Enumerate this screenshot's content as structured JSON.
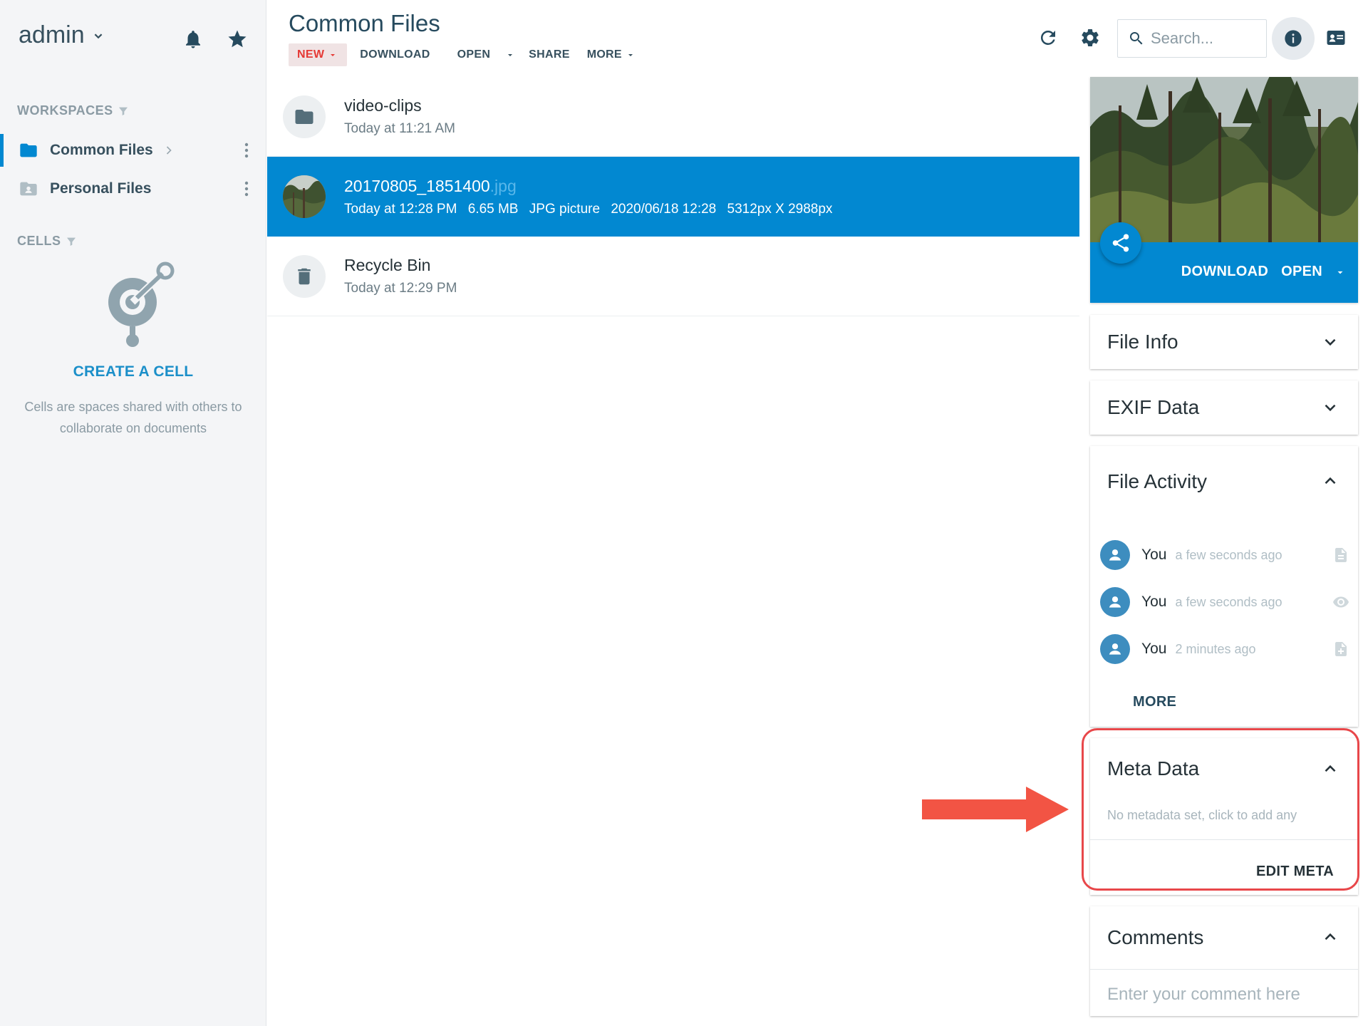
{
  "sidebar": {
    "username": "admin",
    "workspaces_title": "WORKSPACES",
    "workspaces": [
      {
        "label": "Common Files",
        "icon": "folder-icon",
        "active": true
      },
      {
        "label": "Personal Files",
        "icon": "personal-folder-icon",
        "active": false
      }
    ],
    "cells_title": "CELLS",
    "create_cell": "CREATE A CELL",
    "cells_description": "Cells are spaces shared with others to collaborate on documents"
  },
  "header": {
    "title": "Common Files",
    "toolbar": {
      "new": "NEW",
      "download": "DOWNLOAD",
      "open": "OPEN",
      "share": "SHARE",
      "more": "MORE"
    },
    "search_placeholder": "Search..."
  },
  "files": [
    {
      "name": "video-clips",
      "ext": "",
      "meta": [
        "Today at 11:21 AM"
      ],
      "icon": "folder-icon"
    },
    {
      "name": "20170805_1851400",
      "ext": ".jpg",
      "meta": [
        "Today at 12:28 PM",
        "6.65 MB",
        "JPG picture",
        "2020/06/18 12:28",
        "5312px X 2988px"
      ],
      "icon": "image-thumbnail",
      "selected": true
    },
    {
      "name": "Recycle Bin",
      "ext": "",
      "meta": [
        "Today at 12:29 PM"
      ],
      "icon": "trash-icon"
    }
  ],
  "right_panel": {
    "preview_actions": {
      "download": "DOWNLOAD",
      "open": "OPEN"
    },
    "file_info": {
      "title": "File Info"
    },
    "exif": {
      "title": "EXIF Data"
    },
    "activity": {
      "title": "File Activity",
      "items": [
        {
          "user": "You",
          "time": "a few seconds ago",
          "icon": "file-icon"
        },
        {
          "user": "You",
          "time": "a few seconds ago",
          "icon": "eye-icon"
        },
        {
          "user": "You",
          "time": "2 minutes ago",
          "icon": "file-add-icon"
        }
      ],
      "more": "MORE"
    },
    "meta": {
      "title": "Meta Data",
      "empty": "No metadata set, click to add any",
      "edit": "EDIT META"
    },
    "comments": {
      "title": "Comments",
      "placeholder": "Enter your comment here"
    }
  },
  "colors": {
    "accent": "#0288d1",
    "highlight": "#e8474a",
    "new_button_text": "#e53935"
  }
}
